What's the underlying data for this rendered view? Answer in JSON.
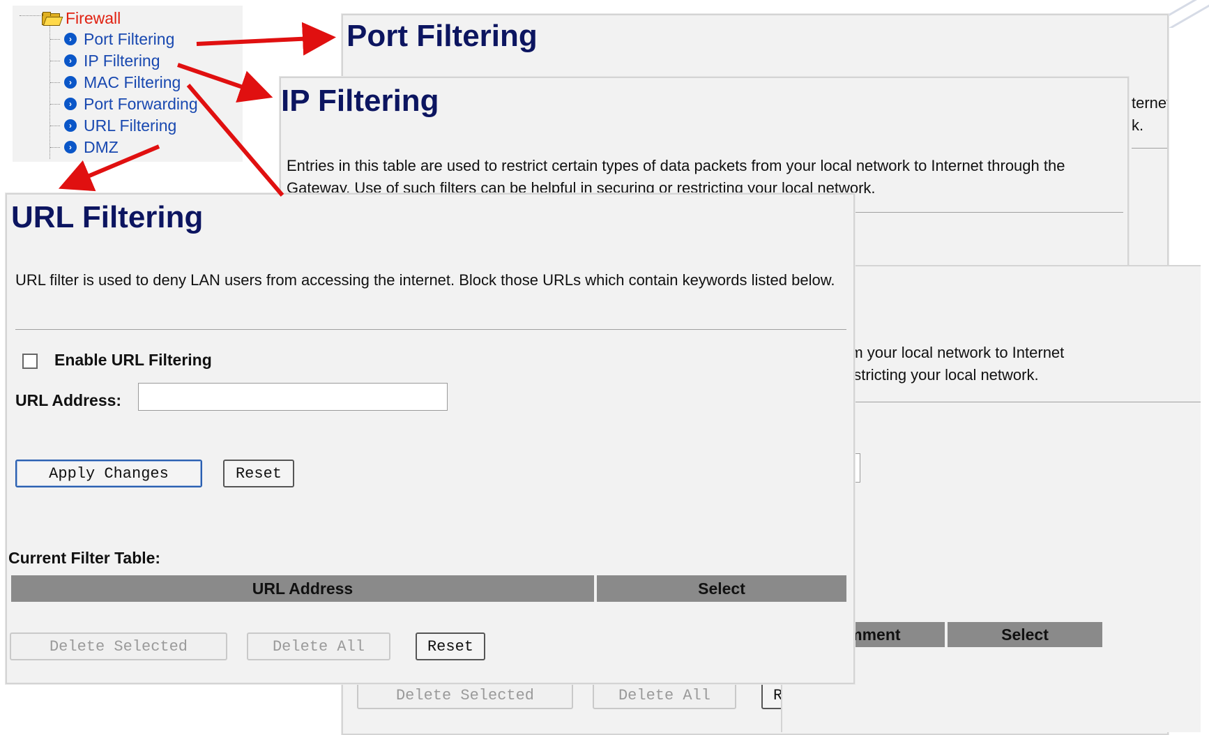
{
  "tree": {
    "root_label": "Firewall",
    "items": [
      {
        "label": "Port Filtering"
      },
      {
        "label": "IP Filtering"
      },
      {
        "label": "MAC Filtering"
      },
      {
        "label": "Port Forwarding"
      },
      {
        "label": "URL Filtering"
      },
      {
        "label": "DMZ"
      }
    ]
  },
  "port_panel": {
    "title": "Port Filtering",
    "partial_lines": [
      "ternet",
      "k."
    ],
    "buttons": {
      "delete_selected": "Delete Selected",
      "delete_all": "Delete All",
      "reset": "Reset"
    }
  },
  "ip_panel": {
    "title": "IP Filtering",
    "description": "Entries in this table are used to restrict certain types of data packets from your local network to Internet through the Gateway. Use of such filters can be helpful in securing or restricting your local network."
  },
  "mac_panel": {
    "partial_desc_1": "ackets from your local network to Internet",
    "partial_desc_2": "uring or restricting your local network.",
    "table_headers": {
      "comment": "Comment",
      "select": "Select"
    }
  },
  "url_panel": {
    "title": "URL Filtering",
    "description": "URL filter is used to deny LAN users from accessing the internet. Block those URLs which contain keywords listed below.",
    "enable_label": "Enable URL Filtering",
    "enable_checked": false,
    "url_address_label": "URL Address:",
    "url_address_value": "",
    "apply_label": "Apply Changes",
    "reset_label": "Reset",
    "table_title": "Current Filter Table:",
    "table_headers": {
      "url_address": "URL Address",
      "select": "Select"
    },
    "delete_selected_label": "Delete Selected",
    "delete_all_label": "Delete All",
    "table_reset_label": "Reset"
  },
  "colors": {
    "title": "#0c1560",
    "tree_link": "#1848b0",
    "tree_root": "#e02010",
    "arrow": "#e01010",
    "table_header": "#8a8a8a",
    "panel_bg": "#f2f2f2"
  }
}
